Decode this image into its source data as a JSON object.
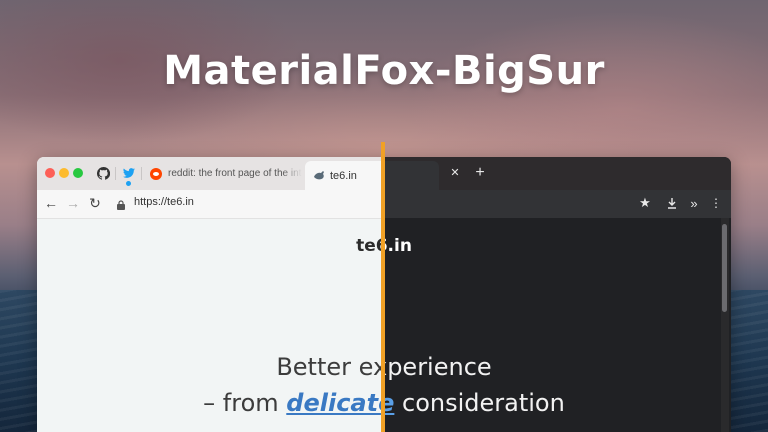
{
  "banner": {
    "title": "MaterialFox-BigSur"
  },
  "tabs": {
    "reddit_label": "reddit: the front page of the inte",
    "active_label": "te6.in",
    "close_glyph": "✕",
    "new_tab_glyph": "+"
  },
  "toolbar": {
    "url": "https://te6.in",
    "back_glyph": "←",
    "forward_glyph": "→",
    "reload_glyph": "↻",
    "star_glyph": "★",
    "download_glyph": "⤓",
    "more_glyph": "»",
    "menu_glyph": "⋮"
  },
  "page": {
    "site_name": "te6.in",
    "tagline_line1": "Better experience",
    "tagline_prefix": "– from ",
    "tagline_emphasis": "delicate",
    "tagline_suffix": " consideration"
  },
  "colors": {
    "divider": "#f1a126",
    "accent_link_light": "#3a79c3",
    "accent_link_dark": "#5aa0e8",
    "dark_bg": "#202124",
    "light_bg": "#f2f5f5"
  },
  "icons": [
    "github-icon",
    "twitter-icon",
    "reddit-icon",
    "firefox-icon",
    "lock-icon",
    "star-icon",
    "download-icon",
    "more-tools-icon",
    "kebab-menu-icon"
  ]
}
